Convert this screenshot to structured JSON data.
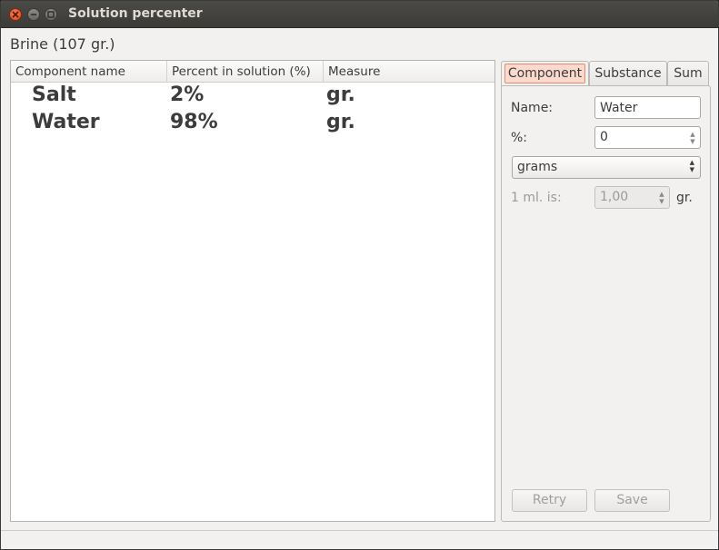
{
  "window": {
    "title": "Solution percenter",
    "controls": [
      "close",
      "minimize",
      "maximize"
    ]
  },
  "heading": "Brine (107 gr.)",
  "table": {
    "columns": [
      "Component name",
      "Percent in solution (%)",
      "Measure"
    ],
    "rows": [
      {
        "name": "Salt",
        "percent": "2%",
        "measure": "gr."
      },
      {
        "name": "Water",
        "percent": "98%",
        "measure": "gr."
      }
    ]
  },
  "tabs": [
    {
      "label": "Component",
      "active": true
    },
    {
      "label": "Substance",
      "active": false
    },
    {
      "label": "Sum",
      "active": false
    }
  ],
  "form": {
    "name_label": "Name:",
    "name_value": "Water",
    "percent_label": "%:",
    "percent_value": "0",
    "unit_selected": "grams",
    "ml_label": "1 ml. is:",
    "ml_value": "1,00",
    "ml_unit": "gr.",
    "retry_label": "Retry",
    "save_label": "Save"
  },
  "colors": {
    "titlebar": "#3c3b37",
    "close_button": "#df4a16",
    "active_tab_highlight": "#fbd9cd",
    "window_bg": "#f2f1f0"
  }
}
